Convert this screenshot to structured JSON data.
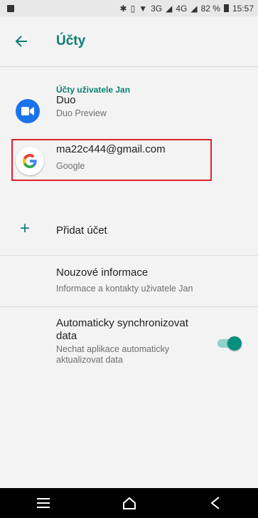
{
  "status_bar": {
    "signal_text": "3G",
    "signal_text_2": "4G",
    "battery_percent": "82 %",
    "time": "15:57"
  },
  "app_bar": {
    "title": "Účty"
  },
  "accounts": {
    "section_header": "Účty uživatele Jan",
    "items": [
      {
        "name": "Duo",
        "type": "Duo Preview",
        "icon": "duo-icon"
      },
      {
        "name": "ma22c444@gmail.com",
        "type": "Google",
        "icon": "google-icon"
      }
    ]
  },
  "add_account": {
    "label": "Přidat účet"
  },
  "emergency": {
    "title": "Nouzové informace",
    "subtitle": "Informace a kontakty uživatele Jan"
  },
  "sync": {
    "title_line1": "Automaticky synchronizovat",
    "title_line2": "data",
    "subtitle_line1": "Nechat aplikace automaticky",
    "subtitle_line2": "aktualizovat data",
    "enabled": true
  },
  "nav": {
    "menu_icon": "menu-icon",
    "home_icon": "home-icon",
    "back_icon": "back-icon"
  },
  "colors": {
    "accent": "#0a7f72",
    "highlight": "#e0222d"
  }
}
